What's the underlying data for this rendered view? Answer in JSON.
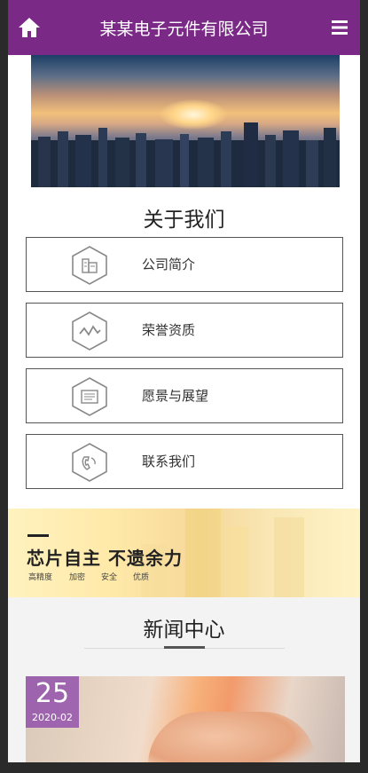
{
  "header": {
    "title": "某某电子元件有限公司",
    "icons": {
      "home": "home-icon",
      "menu": "hamburger-menu-icon"
    },
    "color": "#7a2a86"
  },
  "about": {
    "title": "关于我们",
    "items": [
      {
        "label": "公司简介",
        "icon": "building-icon"
      },
      {
        "label": "荣誉资质",
        "icon": "wave-icon"
      },
      {
        "label": "愿景与展望",
        "icon": "document-icon"
      },
      {
        "label": "联系我们",
        "icon": "phone-icon"
      }
    ]
  },
  "banner": {
    "slogan": "芯片自主 不遗余力",
    "tags": [
      "高精度",
      "加密",
      "安全",
      "优质"
    ]
  },
  "news": {
    "title": "新闻中心",
    "items": [
      {
        "day": "25",
        "year_month": "2020-02"
      }
    ]
  }
}
